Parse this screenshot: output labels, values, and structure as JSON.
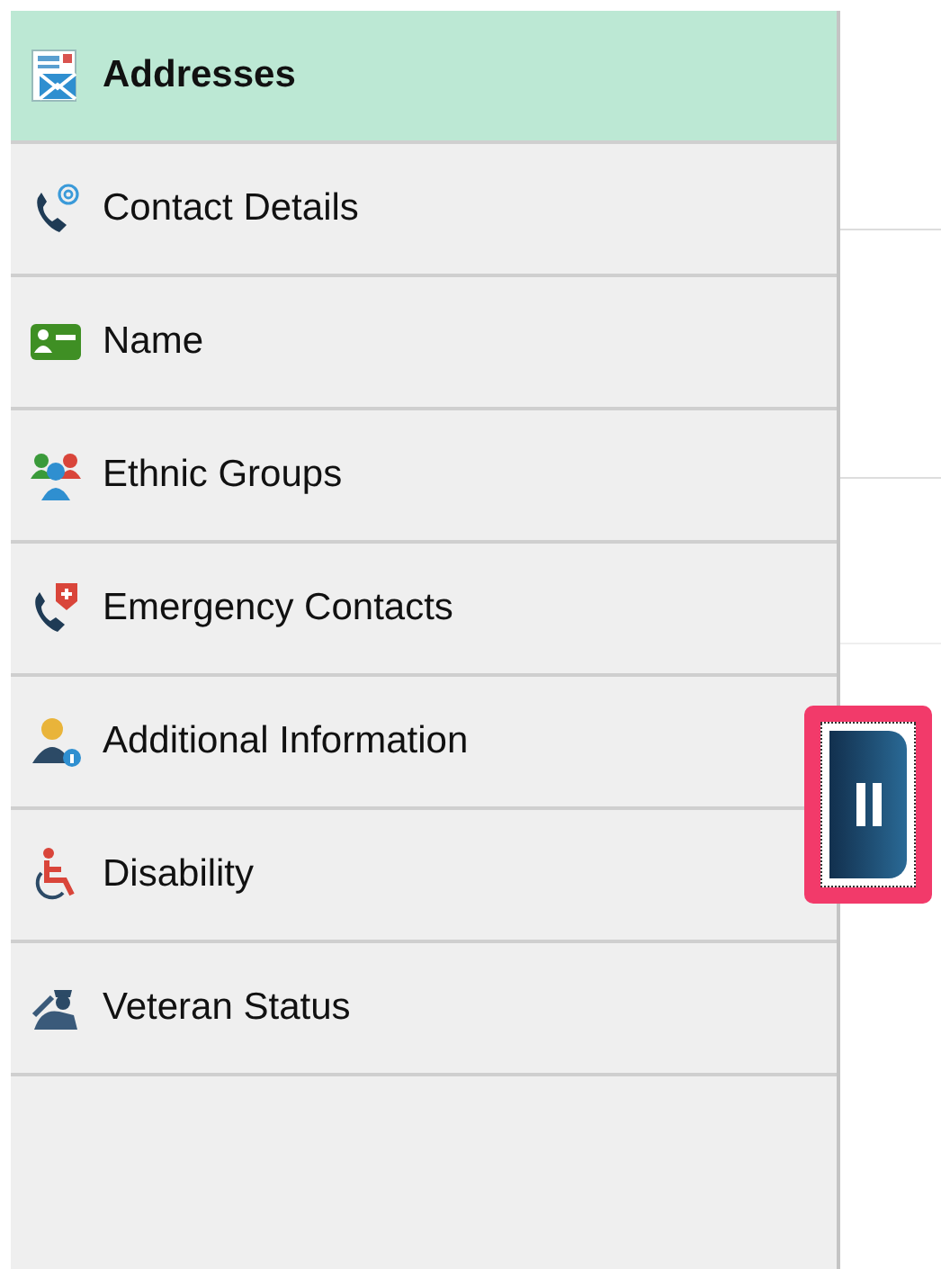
{
  "sidebar": {
    "items": [
      {
        "label": "Addresses",
        "kind": "address",
        "selected": true
      },
      {
        "label": "Contact Details",
        "kind": "contact",
        "selected": false
      },
      {
        "label": "Name",
        "kind": "name",
        "selected": false
      },
      {
        "label": "Ethnic Groups",
        "kind": "groups",
        "selected": false
      },
      {
        "label": "Emergency Contacts",
        "kind": "emergency",
        "selected": false
      },
      {
        "label": "Additional Information",
        "kind": "info",
        "selected": false
      },
      {
        "label": "Disability",
        "kind": "disability",
        "selected": false
      },
      {
        "label": "Veteran Status",
        "kind": "veteran",
        "selected": false
      }
    ]
  }
}
